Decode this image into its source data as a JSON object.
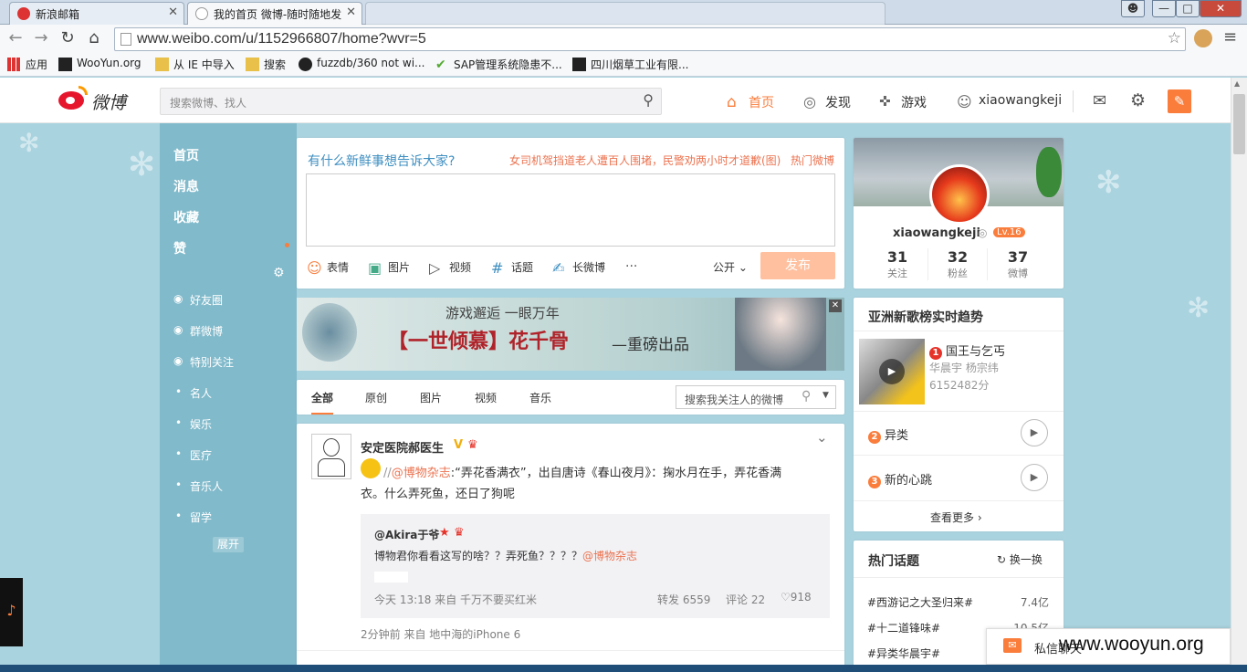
{
  "browser": {
    "tabs": [
      {
        "title": "新浪邮箱"
      },
      {
        "title": "我的首页 微博-随时随地发"
      },
      {
        "title": ""
      }
    ],
    "url": "www.weibo.com/u/1152966807/home?wvr=5",
    "bookmarks": [
      "应用",
      "WooYun.org",
      "从 IE 中导入",
      "搜索",
      "fuzzdb/360 not wi...",
      "SAP管理系统隐患不...",
      "四川烟草工业有限..."
    ],
    "window_buttons": [
      "—",
      "□",
      "✕"
    ]
  },
  "header": {
    "logo_text": "微博",
    "search_placeholder": "搜索微博、找人",
    "nav": [
      {
        "label": "首页",
        "icon": "home-icon"
      },
      {
        "label": "发现",
        "icon": "compass-icon"
      },
      {
        "label": "游戏",
        "icon": "gamepad-icon"
      },
      {
        "label": "xiaowangkeji",
        "icon": "user-icon"
      }
    ]
  },
  "sidebar": {
    "main": [
      "首页",
      "消息",
      "收藏",
      "赞"
    ],
    "groups": [
      "好友圈",
      "群微博",
      "特别关注"
    ],
    "sub": [
      "名人",
      "娱乐",
      "医疗",
      "音乐人",
      "留学"
    ],
    "expand": "展开"
  },
  "composer": {
    "prompt": "有什么新鲜事想告诉大家?",
    "hot_news": "女司机驾挡道老人遭百人围堵，民警劝两小时才道歉(图)",
    "hot_link": "热门微博",
    "tools": [
      "表情",
      "图片",
      "视频",
      "话题",
      "长微博",
      "···"
    ],
    "visibility": "公开",
    "publish": "发布"
  },
  "banner": {
    "line1": "游戏邂逅 一眼万年",
    "line2": "【一世倾慕】花千骨",
    "line3": "—重磅出品"
  },
  "feed_tabs": {
    "tabs": [
      "全部",
      "原创",
      "图片",
      "视频",
      "音乐"
    ],
    "search_placeholder": "搜索我关注人的微博"
  },
  "post": {
    "author": "安定医院郝医生",
    "mention": "@博物杂志",
    "text_a": ":“弄花香满衣”，出自唐诗《春山夜月》：掬水月在手，弄花香满",
    "text_b": "衣。什么弄死鱼，还日了狗呢",
    "repost": {
      "author": "@Akira于爷",
      "text": "博物君你看看这写的啥？？弄死鱼？？？？",
      "mention": "@博物杂志",
      "meta": "今天 13:18 来自 千万不要买红米",
      "forward": "转发 6559",
      "comment": "评论 22",
      "like": "918"
    },
    "meta": "2分钟前 来自 地中海的iPhone 6"
  },
  "profile": {
    "name": "xiaowangkeji",
    "level": "Lv.16",
    "stats": [
      {
        "value": "31",
        "label": "关注"
      },
      {
        "value": "32",
        "label": "粉丝"
      },
      {
        "value": "37",
        "label": "微博"
      }
    ]
  },
  "music": {
    "title": "亚洲新歌榜实时趋势",
    "songs": [
      {
        "rank": "1",
        "name": "国王与乞丐",
        "artist": "华晨宇 杨宗纬",
        "score": "6152482分"
      },
      {
        "rank": "2",
        "name": "异类"
      },
      {
        "rank": "3",
        "name": "新的心跳"
      }
    ],
    "more": "查看更多 ›"
  },
  "topics": {
    "title": "热门话题",
    "refresh": "换一换",
    "items": [
      {
        "name": "#西游记之大圣归来#",
        "value": "7.4亿"
      },
      {
        "name": "#十二道锋味#",
        "value": "10.5亿"
      },
      {
        "name": "#异类华晨宇#",
        "value": ""
      }
    ]
  },
  "chat": {
    "label": "私信聊天"
  },
  "watermark": "www.wooyun.org",
  "colors": {
    "accent": "#fa7d3c",
    "link": "#eb7350",
    "sidebar": "#7cb7c9",
    "bg": "#a9d3df"
  }
}
